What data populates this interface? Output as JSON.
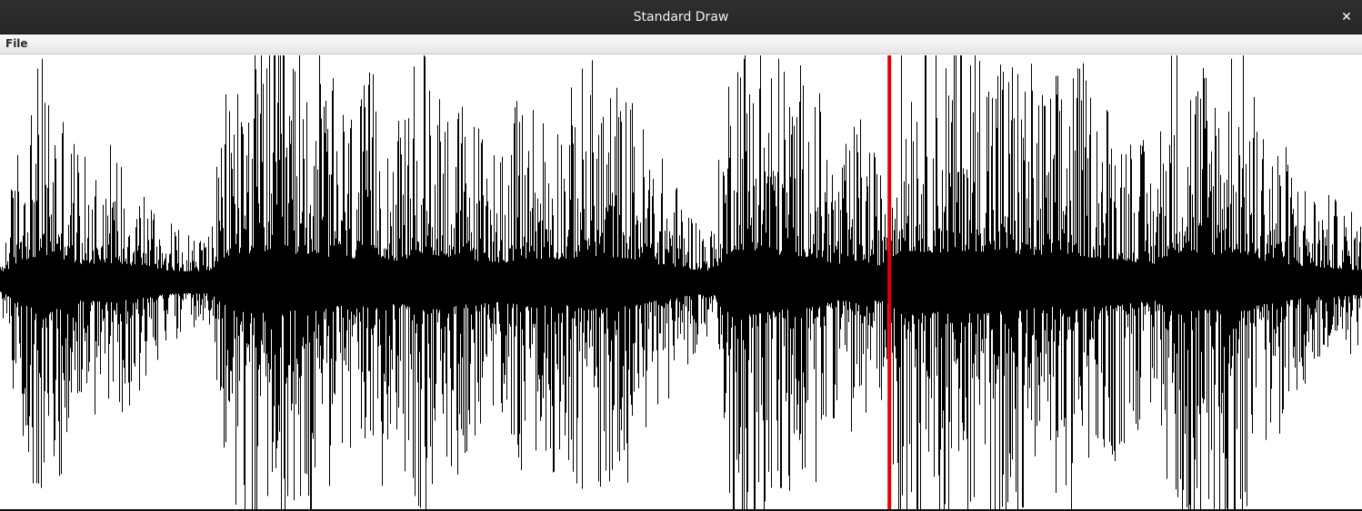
{
  "window": {
    "title": "Standard Draw",
    "close_glyph": "✕"
  },
  "menu": {
    "items": [
      {
        "label": "File"
      }
    ]
  },
  "chart_data": {
    "type": "area",
    "series": [
      {
        "values": [
          0.03,
          0.55,
          0.72,
          0.6,
          0.38,
          0.48,
          0.4,
          0.3,
          0.18,
          0.14,
          0.16,
          0.75,
          0.82,
          0.9,
          0.78,
          0.8,
          0.62,
          0.58,
          0.7,
          0.5,
          0.78,
          0.72,
          0.58,
          0.52,
          0.46,
          0.62,
          0.6,
          0.58,
          0.74,
          0.67,
          0.62,
          0.46,
          0.34,
          0.22,
          0.16,
          0.95,
          0.92,
          0.76,
          0.72,
          0.63,
          0.36,
          0.55,
          0.35,
          0.9,
          0.86,
          0.82,
          0.9,
          0.87,
          0.78,
          0.74,
          0.62,
          0.77,
          0.66,
          0.6,
          0.52,
          0.38,
          0.86,
          0.78,
          0.75,
          0.87,
          0.58,
          0.48,
          0.34,
          0.28,
          0.24,
          0.18
        ],
        "color": "#000000"
      }
    ],
    "xlim": [
      0,
      1
    ],
    "ylim": [
      -1,
      1
    ],
    "grid": false,
    "cursor": {
      "position": 0.653,
      "color": "#e60000"
    }
  }
}
